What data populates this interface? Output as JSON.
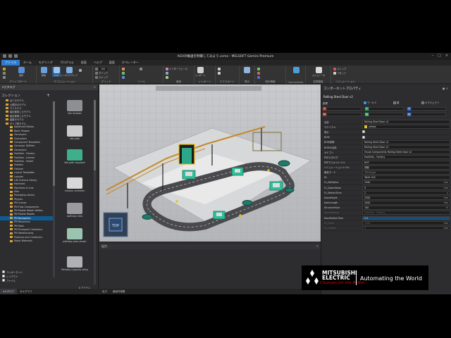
{
  "window": {
    "title": "AGVの輸送を制御してみよう.vcmx - MELSOFT Gemini Premium"
  },
  "menu": [
    "ファイル",
    "ホーム",
    "モデリング",
    "プログラム",
    "画面",
    "ヘルプ",
    "図面",
    "オペレーター"
  ],
  "ribbon": {
    "groups": [
      {
        "label": "クリップボード"
      },
      {
        "label": "マニピュレーション"
      },
      {
        "label": "グリッド"
      },
      {
        "label": "ツール"
      },
      {
        "label": "接続"
      },
      {
        "label": "インポート"
      },
      {
        "label": "エクスポート"
      },
      {
        "label": "表示"
      },
      {
        "label": "統計情報"
      },
      {
        "label": "Connectivity"
      },
      {
        "label": "拡張機能"
      },
      {
        "label": "シミュレーション"
      }
    ],
    "buttons": [
      "選択",
      "移動",
      "PnP",
      "インタラクティブ",
      "エミュレータ",
      "インターフェース",
      "インポート",
      "エクスポート",
      "統計",
      "エクスポートエ-",
      "ストップ",
      "リセット"
    ],
    "snap_label": "スナップ",
    "grid_label": "グリッド",
    "value": "100"
  },
  "left_panel": {
    "header": "eカタログ",
    "collection_title": "コレクション",
    "tree": [
      "全てのモデル",
      "公開中のモデル",
      "マイモデル",
      "最近使用したモデル",
      "最近使用したモデル",
      "最新のモデル",
      "タイプ別モデル",
      "Advanced Motion",
      "Basic Shapes",
      "Conveyors",
      "Characters",
      "Component Templates",
      "Conveyor Utilities",
      "Conveyors",
      "Facilities - Factory",
      "Facilities - Interior",
      "Facilities - Robot",
      "Feeders",
      "Fixtures",
      "Layout Templates",
      "Layouts",
      "Life Science Library",
      "Machines",
      "Machines In-Line",
      "Misc",
      "Packaging Library",
      "Physics",
      "PM Cranes",
      "PM Flow Components",
      "PM Mobile Robot Utilities",
      "PM Mobile Robots",
      "PM Navigation",
      "PM Resources",
      "PM Tools",
      "PM Transport Controllers",
      "PM Warehousing",
      "Products and Containers",
      "Robot Materials"
    ],
    "selected_index": 31,
    "thumbnails": [
      "idle location",
      "idle path",
      "idle path waypoint",
      "mission controller",
      "pathway area",
      "pathway area sensor",
      "Pathway Capacity setup"
    ],
    "checks": [
      "コンポーネント",
      "レイアウト",
      "ファイル"
    ],
    "selection_label": "0 アイテム",
    "tabs": [
      "eカタログ",
      "セルグラフ"
    ]
  },
  "viewport": {
    "nav_cube_label": "TOP"
  },
  "output_panel": {
    "header": "出力",
    "tabs": [
      "出力",
      "製品作成数"
    ]
  },
  "props": {
    "title": "コンポーネントプロパティ",
    "component_name": "Rolling Steel Door v2",
    "coord_label": "座標",
    "coord_options": [
      "ワールド",
      "親",
      "オブジェクト"
    ],
    "axis_labels": [
      "X",
      "Y",
      "Z",
      "Rx",
      "Ry",
      "Rz"
    ],
    "rows": [
      {
        "k": "名前",
        "v": "Rolling Steel Door v2",
        "type": "text"
      },
      {
        "k": "マテリアル",
        "v": "yellow",
        "type": "swatch"
      },
      {
        "k": "表示",
        "v": "",
        "type": "check"
      },
      {
        "k": "BOM",
        "v": "",
        "type": "check"
      },
      {
        "k": "BOM説明",
        "v": "Rolling Steel Door v2",
        "type": "text"
      },
      {
        "k": "BOMの名前",
        "v": "Rolling Steel Door v2",
        "type": "text"
      },
      {
        "k": "カテゴリ",
        "v": "Visual Components Rolling Steel Door v2",
        "type": "text"
      },
      {
        "k": "PDFカタログ",
        "v": "Facilities - Factory",
        "type": "text"
      },
      {
        "k": "PDFでスキルレベル",
        "v": "NOT",
        "type": "text"
      },
      {
        "k": "シミュレーションレベル",
        "v": "詳細",
        "type": "text"
      },
      {
        "k": "衝突モード",
        "v": "コリジョン",
        "type": "text"
      },
      {
        "k": "ID",
        "v": "3843-532",
        "type": "text"
      },
      {
        "k": "FL_RollValue",
        "v": "2500",
        "u": "mm",
        "type": "text"
      },
      {
        "k": "FL_DownValue",
        "v": "0",
        "u": "mm",
        "type": "text"
      },
      {
        "k": "FL_MotionTime",
        "v": "2",
        "u": "s",
        "type": "text"
      },
      {
        "k": "DoorHeight",
        "v": "2500",
        "u": "mm",
        "type": "text"
      },
      {
        "k": "DoorLength",
        "v": "2000",
        "u": "mm",
        "type": "text"
      },
      {
        "k": "StructureSize",
        "v": "100",
        "u": "%",
        "type": "text"
      },
      {
        "k": "DoorMaterial",
        "v": "Facilities - Factory",
        "type": "text",
        "dim": true
      },
      {
        "k": "DoorMotionTime",
        "v": "2.5",
        "type": "sel"
      },
      {
        "k": "FL_Open",
        "v": "2500",
        "u": "mm",
        "type": "text",
        "dim": true
      },
      {
        "k": "FL_Closed",
        "v": "0",
        "u": "mm",
        "type": "text",
        "dim": true
      }
    ]
  },
  "logo": {
    "brand_line1": "MITSUBISHI",
    "brand_line2": "ELECTRIC",
    "slogan": "Changes for the Better",
    "tagline": "Automating the World"
  },
  "colors": {
    "accent": "#2e7bcf",
    "selection": "#0e5a94",
    "logo_red": "#e60012",
    "agv_green": "#2fbf9a",
    "yellow": "#e8c21a"
  }
}
